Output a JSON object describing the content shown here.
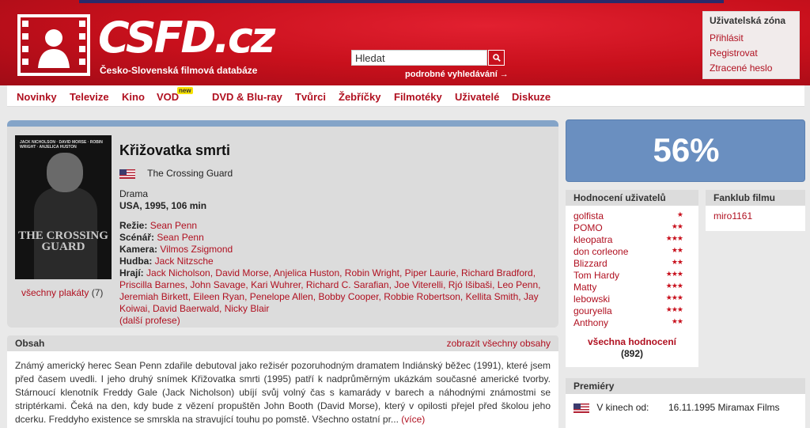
{
  "logo": {
    "text": "CSFD.cz",
    "subtitle": "Česko-Slovenská filmová databáze"
  },
  "search": {
    "value": "Hledat",
    "button_icon": "search-icon",
    "advanced": "podrobné vyhledávání →"
  },
  "user_zone": {
    "title": "Uživatelská zóna",
    "links": [
      "Přihlásit",
      "Registrovat",
      "Ztracené heslo"
    ]
  },
  "nav": {
    "items": [
      "Novinky",
      "Televize",
      "Kino",
      "VOD",
      "DVD & Blu-ray",
      "Tvůrci",
      "Žebříčky",
      "Filmotéky",
      "Uživatelé",
      "Diskuze"
    ],
    "vod_badge": "new"
  },
  "film": {
    "title": "Křižovatka smrti",
    "original_title": "The Crossing Guard",
    "genre": "Drama",
    "origin": "USA, 1995, 106 min",
    "poster_title": "THE CROSSING GUARD",
    "poster_names": "JACK NICHOLSON · DAVID MORSE · ROBIN WRIGHT · ANJELICA HUSTON",
    "all_posters": "všechny plakáty",
    "poster_count": "(7)",
    "directing_label": "Režie:",
    "directing": "Sean Penn",
    "writing_label": "Scénář:",
    "writing": "Sean Penn",
    "camera_label": "Kamera:",
    "camera": "Vilmos Zsigmond",
    "music_label": "Hudba:",
    "music": "Jack Nitzsche",
    "cast_label": "Hrají:",
    "cast": "Jack Nicholson, David Morse, Anjelica Huston, Robin Wright, Piper Laurie, Richard Bradford, Priscilla Barnes, John Savage, Kari Wuhrer, Richard C. Sarafian, Joe Viterelli, Rjó Išibaši, Leo Penn, Jeremiah Birkett, Eileen Ryan, Penelope Allen, Bobby Cooper, Robbie Robertson, Kellita Smith, Jay Koiwai, David Baerwald, Nicky Blair",
    "more_professions": "(další profese)"
  },
  "synopsis": {
    "title": "Obsah",
    "show_all": "zobrazit všechny obsahy",
    "text": "Známý americký herec Sean Penn zdařile debutoval jako režisér pozoruhodným dramatem Indiánský běžec (1991), které jsem před časem uvedli. I jeho druhý snímek Křižovatka smrti (1995) patří k nadprůměrným ukázkám současné americké tvorby. Stárnoucí klenotník Freddy Gale (Jack Nicholson) ubíjí svůj volný čas s kamarády v barech a náhodnými známostmi se striptérkami. Čeká na den, kdy bude z vězení propuštěn John Booth (David Morse), který v opilosti přejel před školou jeho dcerku. Freddyho existence se smrskla na stravující touhu po pomstě. Všechno ostatní pr...",
    "more": "(více)"
  },
  "rating": {
    "percent": "56%",
    "box_color": "#6a8fc0"
  },
  "user_ratings": {
    "title": "Hodnocení uživatelů",
    "rows": [
      {
        "user": "golfista",
        "stars": "★",
        "star_count": 1
      },
      {
        "user": "POMO",
        "stars": "★★",
        "star_count": 2
      },
      {
        "user": "kleopatra",
        "stars": "★★★",
        "star_count": 3
      },
      {
        "user": "don corleone",
        "stars": "★★",
        "star_count": 2
      },
      {
        "user": "Blizzard",
        "stars": "★★",
        "star_count": 2
      },
      {
        "user": "Tom Hardy",
        "stars": "★★★",
        "star_count": 3
      },
      {
        "user": "Matty",
        "stars": "★★★",
        "star_count": 3
      },
      {
        "user": "lebowski",
        "stars": "★★★",
        "star_count": 3
      },
      {
        "user": "gouryella",
        "stars": "★★★",
        "star_count": 3
      },
      {
        "user": "Anthony",
        "stars": "★★",
        "star_count": 2
      }
    ],
    "all_label": "všechna hodnocení",
    "all_count": "(892)"
  },
  "fanclub": {
    "title": "Fanklub filmu",
    "members": [
      "miro1161"
    ]
  },
  "premieres": {
    "title": "Premiéry",
    "label": "V kinech od:",
    "date": "16.11.1995 Miramax Films"
  },
  "colors": {
    "brand_red": "#c8101c",
    "link": "#b01020",
    "star": "#c8101c",
    "nav_accent": "#84a4c8"
  }
}
